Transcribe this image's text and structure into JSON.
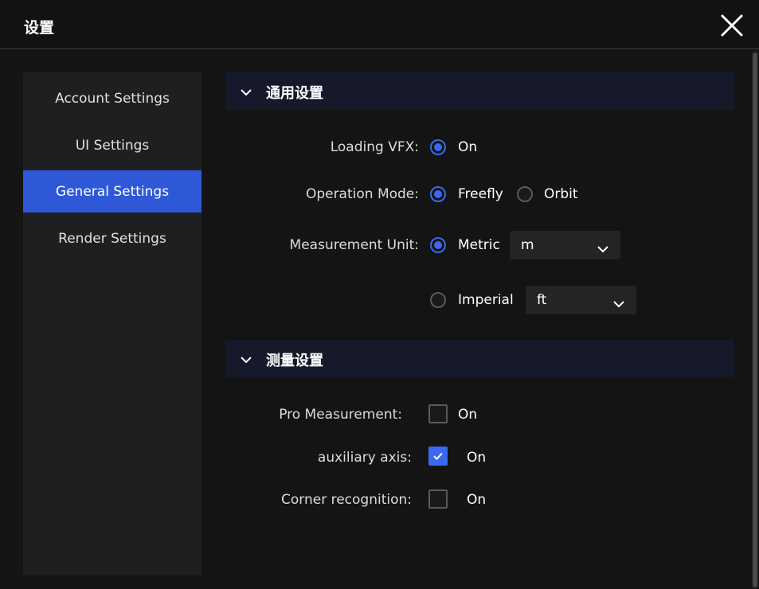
{
  "window": {
    "title": "设置"
  },
  "sidebar": {
    "items": [
      {
        "label": "Account Settings",
        "active": false
      },
      {
        "label": "UI Settings",
        "active": false
      },
      {
        "label": "General Settings",
        "active": true
      },
      {
        "label": "Render Settings",
        "active": false
      }
    ]
  },
  "general": {
    "title": "通用设置",
    "loading_vfx": {
      "label": "Loading VFX:",
      "option": "On",
      "selected": true
    },
    "operation_mode": {
      "label": "Operation Mode:",
      "options": [
        "Freefly",
        "Orbit"
      ],
      "selected": "Freefly"
    },
    "measurement_unit": {
      "label": "Measurement Unit:",
      "metric": {
        "label": "Metric",
        "selected": true,
        "unit": "m"
      },
      "imperial": {
        "label": "Imperial",
        "selected": false,
        "unit": "ft"
      }
    }
  },
  "measure": {
    "title": "测量设置",
    "pro_measurement": {
      "label": "Pro Measurement:",
      "value": "On",
      "checked": false
    },
    "auxiliary_axis": {
      "label": "auxiliary axis:",
      "value": "On",
      "checked": true
    },
    "corner_recognition": {
      "label": "Corner recognition:",
      "value": "On",
      "checked": false
    }
  },
  "colors": {
    "accent": "#3a68f0",
    "active_nav": "#2f58d6",
    "section_bg": "#16192a"
  }
}
